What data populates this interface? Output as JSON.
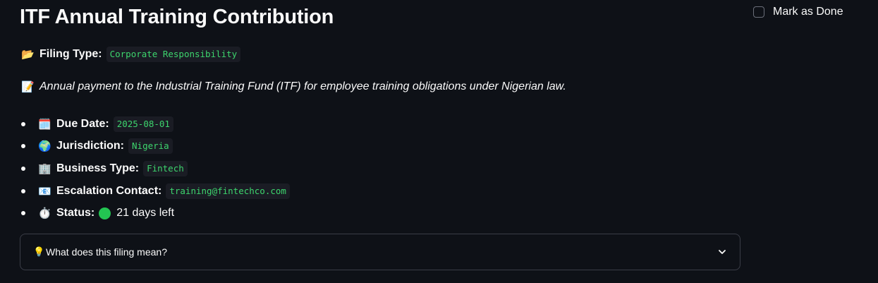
{
  "title": "ITF Annual Training Contribution",
  "mark_done": {
    "label": "Mark as Done",
    "checked": false
  },
  "filing": {
    "icon": "📂",
    "label": "Filing Type:",
    "value": "Corporate Responsibility"
  },
  "description": {
    "icon": "📝",
    "text": "Annual payment to the Industrial Training Fund (ITF) for employee training obligations under Nigerian law."
  },
  "details": [
    {
      "icon": "🗓️",
      "label": "Due Date:",
      "value": "2025-08-01"
    },
    {
      "icon": "🌍",
      "label": "Jurisdiction:",
      "value": "Nigeria"
    },
    {
      "icon": "🏢",
      "label": "Business Type:",
      "value": "Fintech"
    },
    {
      "icon": "📧",
      "label": "Escalation Contact:",
      "value": "training@fintechco.com"
    }
  ],
  "status": {
    "icon": "⏱️",
    "label": "Status:",
    "text": "21 days left",
    "color": "#23c552"
  },
  "expander": {
    "icon": "💡",
    "label": "What does this filing mean?",
    "expanded": false
  },
  "colors": {
    "background": "#0e1117",
    "code_text": "#3dd56d",
    "code_bg": "#1a1c24",
    "border": "#3a3d47"
  }
}
